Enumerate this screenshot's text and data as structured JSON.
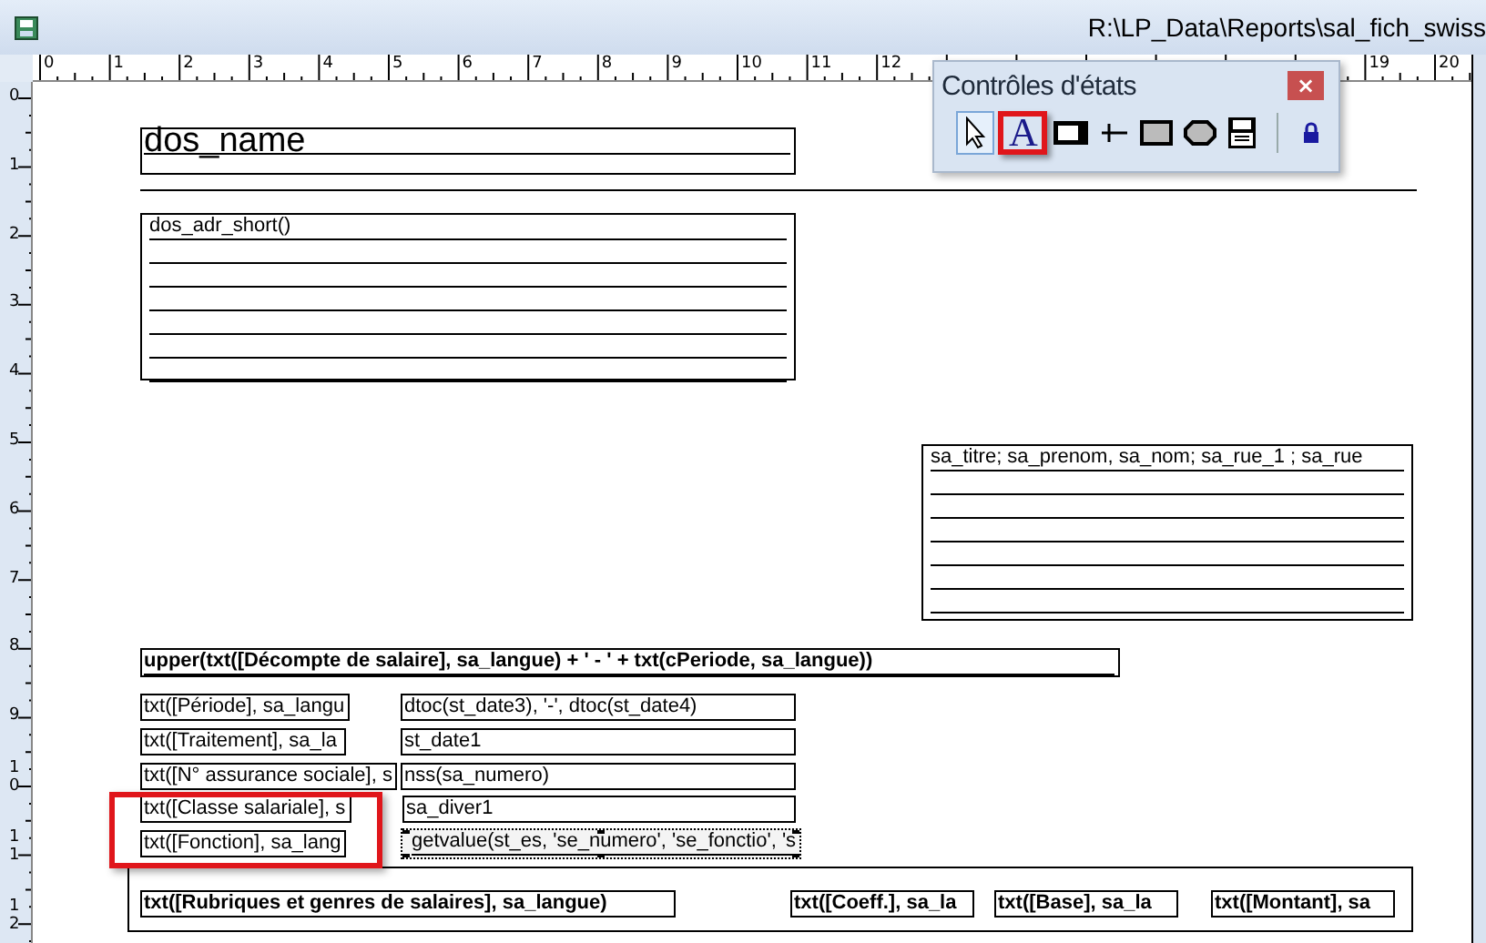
{
  "window": {
    "title": "R:\\LP_Data\\Reports\\sal_fich_swiss"
  },
  "ruler": {
    "horizontal": [
      "0",
      "1",
      "2",
      "3",
      "4",
      "5",
      "6",
      "7",
      "8",
      "9",
      "10",
      "11",
      "12",
      "19",
      "20"
    ],
    "vertical": [
      "0",
      "1",
      "2",
      "3",
      "4",
      "5",
      "6",
      "7",
      "8",
      "9",
      "10",
      "11",
      "12"
    ]
  },
  "toolbox": {
    "title": "Contrôles d'états",
    "close": "×",
    "tools": [
      {
        "kind": "pointer",
        "selected": true,
        "highlighted": false
      },
      {
        "kind": "label",
        "glyph": "A",
        "selected": false,
        "highlighted": true
      },
      {
        "kind": "textbox",
        "selected": false,
        "highlighted": false
      },
      {
        "kind": "line",
        "selected": false,
        "highlighted": false
      },
      {
        "kind": "rectangle",
        "selected": false,
        "highlighted": false
      },
      {
        "kind": "ellipse",
        "selected": false,
        "highlighted": false
      },
      {
        "kind": "ole",
        "selected": false,
        "highlighted": false
      },
      {
        "kind": "lock",
        "selected": false,
        "highlighted": false
      }
    ]
  },
  "report": {
    "annotations": [
      {
        "kind": "red-frame"
      }
    ],
    "fields": [
      {
        "kind": "title",
        "text": "dos_name",
        "bold": false,
        "selected": false
      },
      {
        "kind": "multiline",
        "text": "dos_adr_short()",
        "bold": false,
        "selected": false
      },
      {
        "kind": "multiline",
        "text": "sa_titre; sa_prenom, sa_nom; sa_rue_1 ; sa_rue",
        "bold": false,
        "selected": false
      },
      {
        "kind": "single",
        "text": "upper(txt([Décompte de salaire], sa_langue) + ' - ' + txt(cPeriode, sa_langue))",
        "bold": true,
        "selected": false
      },
      {
        "kind": "single",
        "text": "txt([Période], sa_langu",
        "bold": false,
        "selected": false
      },
      {
        "kind": "single",
        "text": "dtoc(st_date3), '-', dtoc(st_date4)",
        "bold": false,
        "selected": false
      },
      {
        "kind": "single",
        "text": "txt([Traitement], sa_la",
        "bold": false,
        "selected": false
      },
      {
        "kind": "single",
        "text": "st_date1",
        "bold": false,
        "selected": false
      },
      {
        "kind": "single",
        "text": "txt([N° assurance sociale], s",
        "bold": false,
        "selected": false
      },
      {
        "kind": "single",
        "text": "nss(sa_numero)",
        "bold": false,
        "selected": false
      },
      {
        "kind": "single",
        "text": "txt([Classe salariale], s",
        "bold": false,
        "selected": false
      },
      {
        "kind": "single",
        "text": "sa_diver1",
        "bold": false,
        "selected": false
      },
      {
        "kind": "single",
        "text": "txt([Fonction], sa_lang",
        "bold": false,
        "selected": false
      },
      {
        "kind": "single",
        "text": "getvalue(st_es, 'se_numero', 'se_fonctio', 's",
        "bold": false,
        "selected": true
      },
      {
        "kind": "single",
        "text": "txt([Rubriques et genres de salaires], sa_langue)",
        "bold": true,
        "selected": false
      },
      {
        "kind": "single",
        "text": "txt([Coeff.], sa_la",
        "bold": true,
        "selected": false
      },
      {
        "kind": "single",
        "text": "txt([Base], sa_la",
        "bold": true,
        "selected": false
      },
      {
        "kind": "single",
        "text": "txt([Montant], sa",
        "bold": true,
        "selected": false
      }
    ]
  }
}
